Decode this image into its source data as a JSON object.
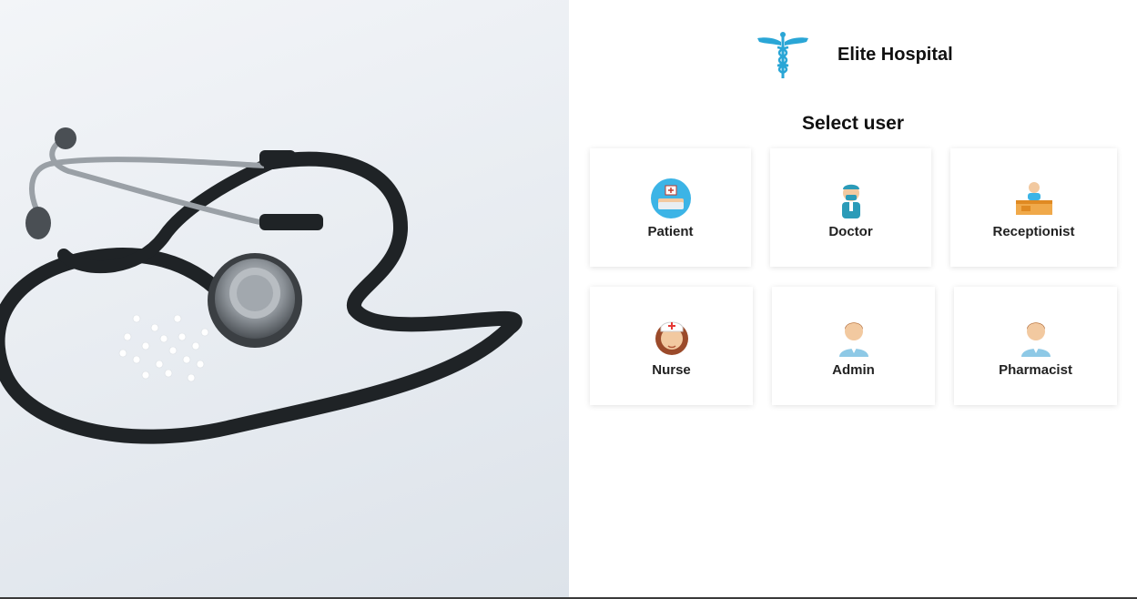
{
  "brand": {
    "name": "Elite Hospital",
    "logo_icon": "caduceus-icon",
    "logo_color": "#2aa6d6"
  },
  "heading": "Select user",
  "users": [
    {
      "label": "Patient",
      "icon": "patient-bed-icon"
    },
    {
      "label": "Doctor",
      "icon": "doctor-icon"
    },
    {
      "label": "Receptionist",
      "icon": "receptionist-icon"
    },
    {
      "label": "Nurse",
      "icon": "nurse-icon"
    },
    {
      "label": "Admin",
      "icon": "admin-icon"
    },
    {
      "label": "Pharmacist",
      "icon": "pharmacist-icon"
    }
  ],
  "hero_image": "stethoscope-photo"
}
